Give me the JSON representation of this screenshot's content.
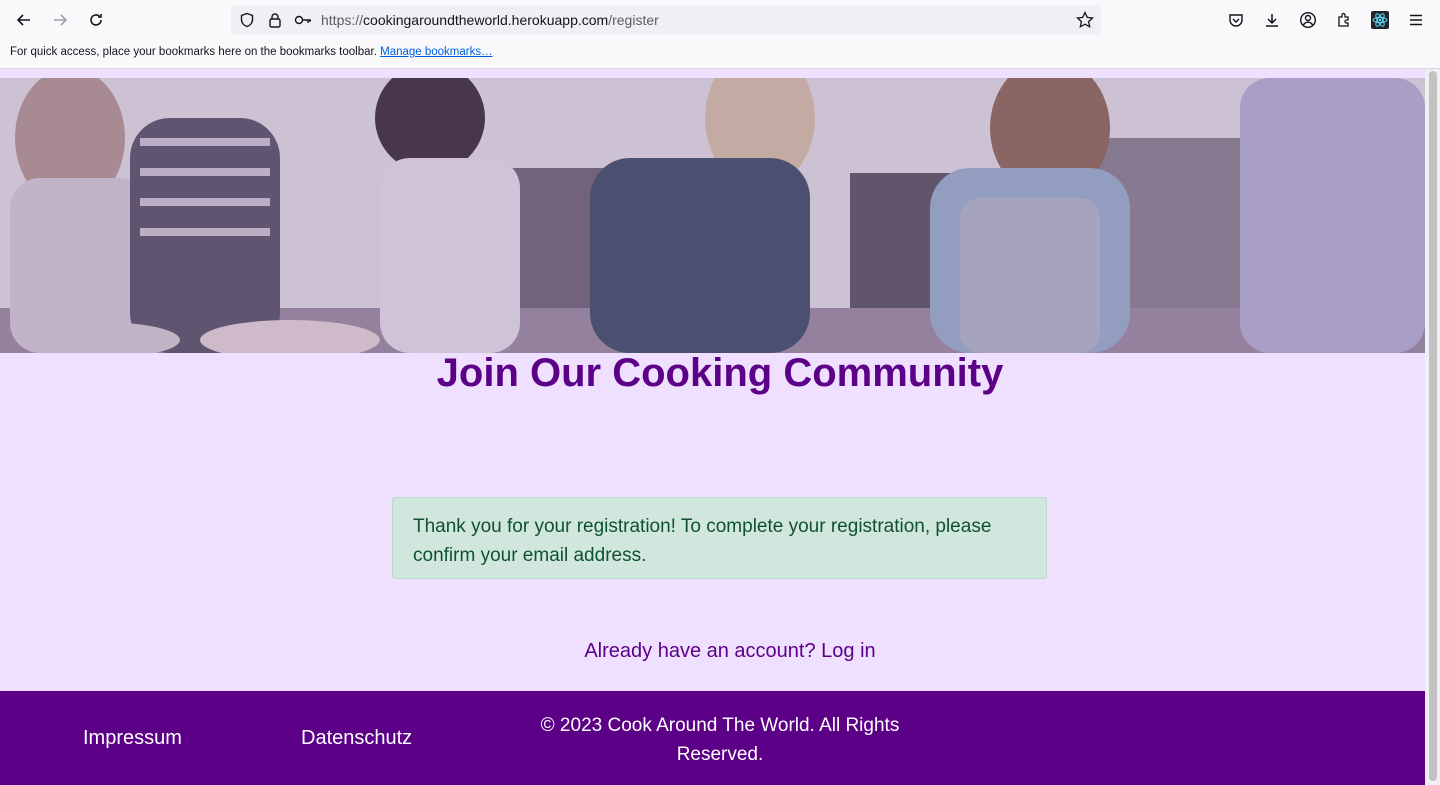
{
  "browser": {
    "url_host": "cookingaroundtheworld.herokuapp.com",
    "url_path": "/register",
    "url_scheme": "https://",
    "bookmarks_message": "For quick access, place your bookmarks here on the bookmarks toolbar.",
    "manage_bookmarks_label": "Manage bookmarks…",
    "icons": [
      "back-icon",
      "forward-icon",
      "reload-icon",
      "shield-icon",
      "lock-icon",
      "key-icon",
      "star-icon",
      "pocket-icon",
      "download-icon",
      "account-icon",
      "extensions-icon",
      "react-devtools-icon",
      "menu-icon"
    ]
  },
  "main": {
    "heading": "Join Our Cooking Community",
    "alert_message": "Thank you for your registration! To complete your registration, please confirm your email address.",
    "login_prompt": "Already have an account? Log in"
  },
  "footer": {
    "impressum_label": "Impressum",
    "datenschutz_label": "Datenschutz",
    "copyright": "© 2023 Cook Around The World. All Rights Reserved."
  },
  "colors": {
    "brand_purple": "#5c0087",
    "page_background": "#f0e0ff",
    "alert_background": "#d1e7dd",
    "alert_text": "#0f5132"
  }
}
